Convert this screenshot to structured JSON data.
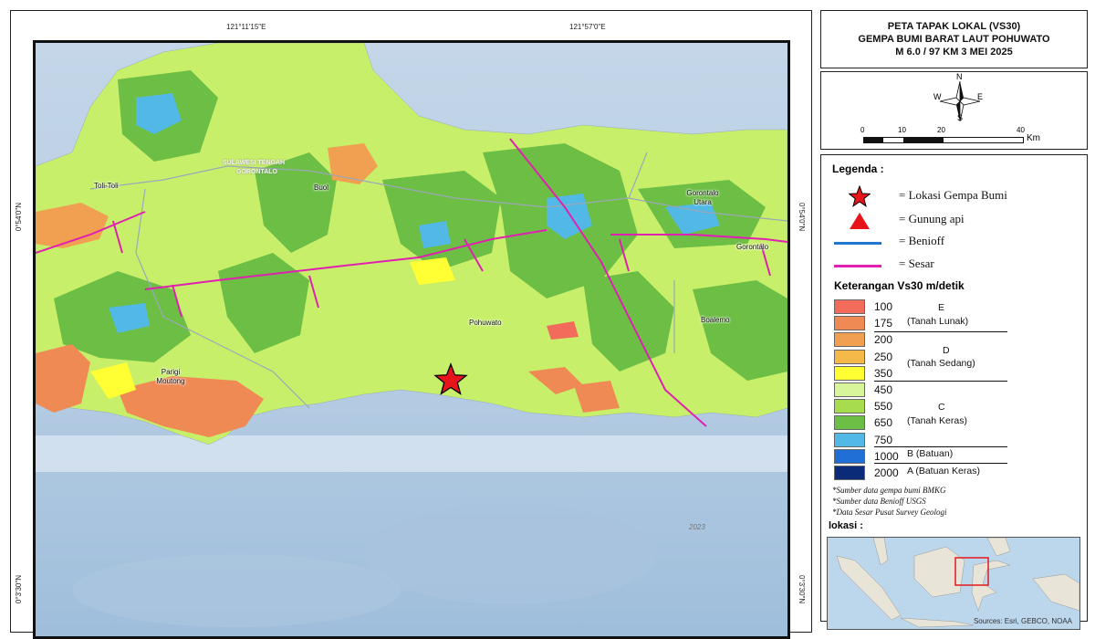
{
  "title": {
    "line1": "PETA TAPAK LOKAL (VS30)",
    "line2": "GEMPA BUMI BARAT LAUT POHUWATO",
    "line3": "M 6.0 / 97 KM  3 MEI 2025"
  },
  "coordinates": {
    "top_left": "121°11'15\"E",
    "top_right": "121°57'0\"E",
    "left_upper": "0°54'0\"N",
    "left_lower": "0°3'30\"N",
    "right_upper": "0°54'0\"N",
    "right_lower": "0°3'30\"N"
  },
  "map_labels": {
    "toli_toli": "Toli-Toli",
    "buol": "Buol",
    "gorontalo_utara": "Gorontalo Utara",
    "gorontalo": "Gorontalo",
    "pohuwato": "Pohuwato",
    "boalemo": "Boalemo",
    "parigi_moutong": "Parigi Moutong",
    "sulawesi_tengah": "SULAWESI TENGAH",
    "gorontalo_prov": "GORONTALO",
    "year": "2023"
  },
  "north_arrow": {
    "n": "N",
    "s": "S",
    "e": "E",
    "w": "W"
  },
  "scale_bar": {
    "ticks": [
      "0",
      "10",
      "20",
      "40"
    ],
    "unit": "Km"
  },
  "legend": {
    "title": "Legenda :",
    "items": [
      {
        "label": "= Lokasi Gempa Bumi",
        "icon": "star-icon"
      },
      {
        "label": "= Gunung api",
        "icon": "triangle-icon"
      },
      {
        "label": "= Benioff",
        "icon": "blue-line-icon"
      },
      {
        "label": "= Sesar",
        "icon": "magenta-line-icon"
      }
    ],
    "vs30_title": "Keterangan Vs30 m/detik",
    "vs30_values": [
      {
        "value": "100",
        "color": "#f26b5b"
      },
      {
        "value": "175",
        "color": "#f08a55"
      },
      {
        "value": "200",
        "color": "#f0a050"
      },
      {
        "value": "250",
        "color": "#f5b94a"
      },
      {
        "value": "350",
        "color": "#ffff33"
      },
      {
        "value": "450",
        "color": "#d8f59a"
      },
      {
        "value": "550",
        "color": "#a6dc4e"
      },
      {
        "value": "650",
        "color": "#6cbe45"
      },
      {
        "value": "750",
        "color": "#52b8e6"
      },
      {
        "value": "1000",
        "color": "#1f6fd6"
      },
      {
        "value": "2000",
        "color": "#0b2a78"
      }
    ],
    "classes": {
      "e_letter": "E",
      "e_desc": "(Tanah Lunak)",
      "d_letter": "D",
      "d_desc": "(Tanah Sedang)",
      "c_letter": "C",
      "c_desc": "(Tanah Keras)",
      "b_desc": "B (Batuan)",
      "a_desc": "A (Batuan Keras)"
    },
    "notes": [
      "*Sumber data gempa bumi BMKG",
      "*Sumber data Benioff USGS",
      "*Data Sesar Pusat Survey Geologi"
    ],
    "lokasi": "lokasi :",
    "inset_credit": "Sources: Esri, GEBCO, NOAA"
  },
  "colors": {
    "sea": "#c9d9ea",
    "land_base": "#c8ef6a",
    "fault": "#e020b0",
    "star": "#e8141c"
  }
}
